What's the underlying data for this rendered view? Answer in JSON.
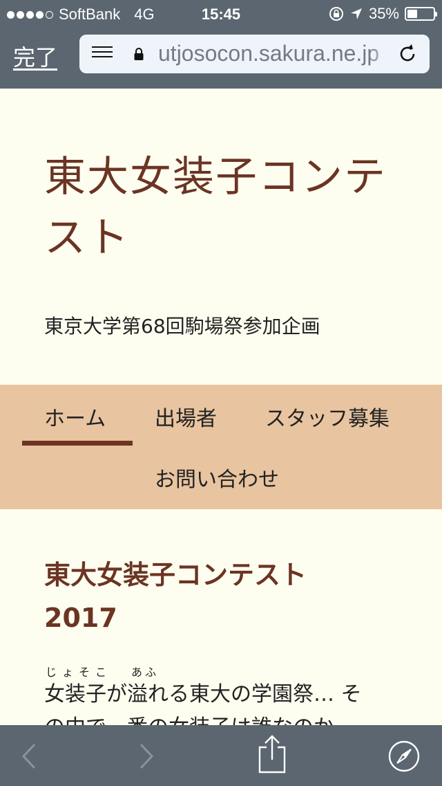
{
  "status_bar": {
    "carrier": "SoftBank",
    "network": "4G",
    "time": "15:45",
    "battery_percent": "35%",
    "battery_level": 0.35,
    "signal_dots_filled": 4,
    "icons": [
      "orientation-lock-icon",
      "location-arrow-icon",
      "battery-icon"
    ]
  },
  "browser": {
    "done_label": "完了",
    "url": "utjosocon.sakura.ne.jp",
    "icons": [
      "reader-icon",
      "lock-icon",
      "reload-icon"
    ]
  },
  "site": {
    "title_line1": "東大女装子コンテ",
    "title_line2": "スト",
    "description": "東京大学第68回駒場祭参加企画"
  },
  "menu": {
    "items": [
      {
        "label": "ホーム",
        "active": true
      },
      {
        "label": "出場者"
      },
      {
        "label": "スタッフ募集"
      },
      {
        "label": "お問い合わせ"
      }
    ]
  },
  "post": {
    "title_line1": "東大女装子コンテスト",
    "title_line2": "2017",
    "ruby_josoko": "じょそこ",
    "ruby_afu": "あふ",
    "line1": "女装子が溢れる東大の学園祭… そ",
    "line2": "の中で一番の女装子は誰なのか——"
  },
  "toolbar": {
    "icons": [
      "back-icon",
      "forward-icon",
      "share-icon",
      "safari-compass-icon"
    ]
  },
  "colors": {
    "chrome": "#5b6670",
    "accent": "#6b3423",
    "menu_bg": "#e8c4a0",
    "page_bg": "#fefef0"
  }
}
